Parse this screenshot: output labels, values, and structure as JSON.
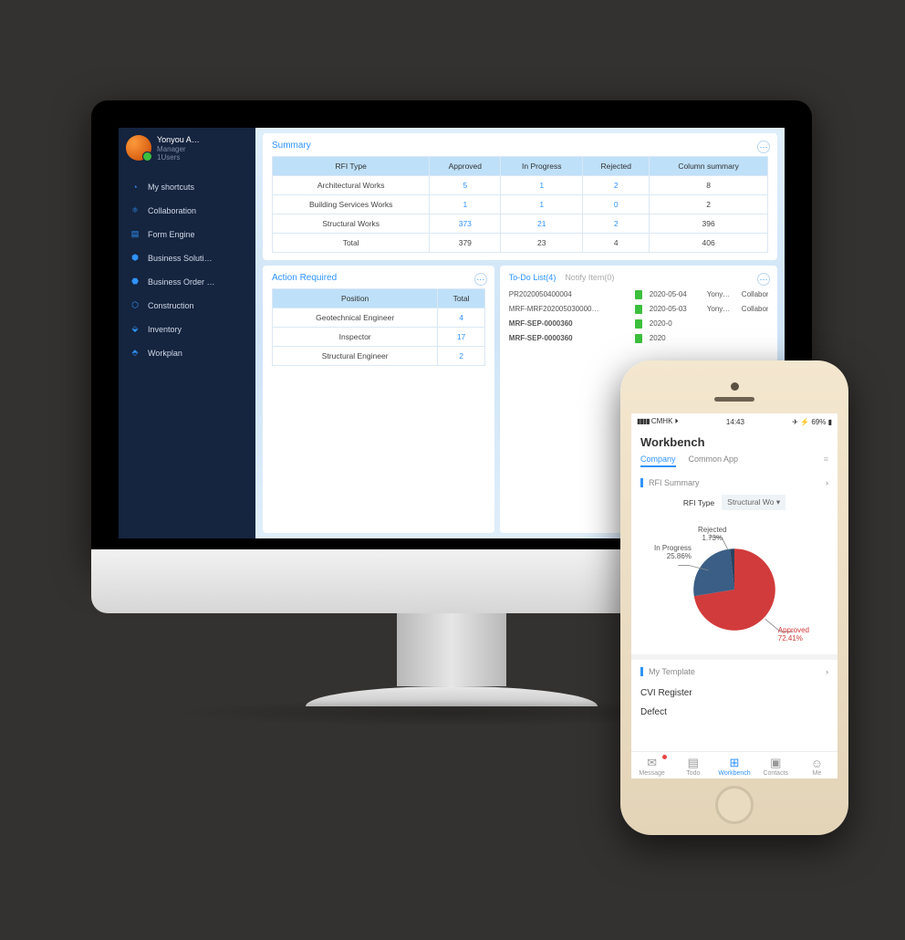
{
  "desktop": {
    "user": {
      "name": "Yonyou A…",
      "role": "Manager",
      "group": "1Users"
    },
    "nav": [
      {
        "icon": "clock",
        "label": "My shortcuts"
      },
      {
        "icon": "share",
        "label": "Collaboration"
      },
      {
        "icon": "form",
        "label": "Form Engine"
      },
      {
        "icon": "cube",
        "label": "Business Soluti…"
      },
      {
        "icon": "order",
        "label": "Business Order …"
      },
      {
        "icon": "box",
        "label": "Construction"
      },
      {
        "icon": "inv",
        "label": "Inventory"
      },
      {
        "icon": "plan",
        "label": "Workplan"
      }
    ],
    "summary": {
      "title": "Summary",
      "headers": [
        "RFI Type",
        "Approved",
        "In Progress",
        "Rejected",
        "Column summary"
      ],
      "rows": [
        {
          "label": "Architectural Works",
          "approved": 5,
          "inprogress": 1,
          "rejected": 2,
          "total": 8
        },
        {
          "label": "Building Services Works",
          "approved": 1,
          "inprogress": 1,
          "rejected": 0,
          "total": 2
        },
        {
          "label": "Structural Works",
          "approved": 373,
          "inprogress": 21,
          "rejected": 2,
          "total": 396
        }
      ],
      "total": {
        "label": "Total",
        "approved": 379,
        "inprogress": 23,
        "rejected": 4,
        "total": 406
      }
    },
    "action": {
      "title": "Action Required",
      "headers": [
        "Position",
        "Total"
      ],
      "rows": [
        {
          "label": "Geotechnical Engineer",
          "value": 4
        },
        {
          "label": "Inspector",
          "value": 17
        },
        {
          "label": "Structural Engineer",
          "value": 2
        }
      ]
    },
    "todo": {
      "tab1": "To-Do List(4)",
      "tab2": "Notify Item(0)",
      "items": [
        {
          "code": "PR2020050400004",
          "bold": false,
          "date": "2020-05-04",
          "user": "Yony…",
          "cat": "Collaboration"
        },
        {
          "code": "MRF-MRF202005030000…",
          "bold": false,
          "date": "2020-05-03",
          "user": "Yony…",
          "cat": "Collaboration"
        },
        {
          "code": "MRF-SEP-0000360",
          "bold": true,
          "date": "2020-0",
          "user": "",
          "cat": ""
        },
        {
          "code": "MRF-SEP-0000360",
          "bold": true,
          "date": "2020",
          "user": "",
          "cat": ""
        }
      ]
    }
  },
  "phone": {
    "status": {
      "carrier": "CMHK",
      "time": "14:43",
      "battery": "69%"
    },
    "title": "Workbench",
    "tabs": {
      "active": "Company",
      "other": "Common App"
    },
    "rfi": {
      "section": "RFI Summary",
      "typeLabel": "RFI Type",
      "typeValue": "Structural Wo"
    },
    "template": {
      "section": "My Template",
      "items": [
        "CVI Register",
        "Defect"
      ]
    },
    "tabbar": [
      {
        "label": "Message",
        "active": false,
        "dot": true
      },
      {
        "label": "Todo",
        "active": false,
        "dot": false
      },
      {
        "label": "Workbench",
        "active": true,
        "dot": false
      },
      {
        "label": "Contacts",
        "active": false,
        "dot": false
      },
      {
        "label": "Me",
        "active": false,
        "dot": false
      }
    ]
  },
  "chart_data": {
    "type": "pie",
    "title": "RFI Summary – Structural Works",
    "slices": [
      {
        "name": "Approved",
        "pct": 72.41,
        "color": "#d23b3b"
      },
      {
        "name": "In Progress",
        "pct": 25.86,
        "color": "#3a5e86"
      },
      {
        "name": "Rejected",
        "pct": 1.73,
        "color": "#2a4460"
      }
    ],
    "labels": {
      "approved": "Approved\n72.41%",
      "inprogress": "In Progress\n25.86%",
      "rejected": "Rejected\n1.73%"
    }
  }
}
